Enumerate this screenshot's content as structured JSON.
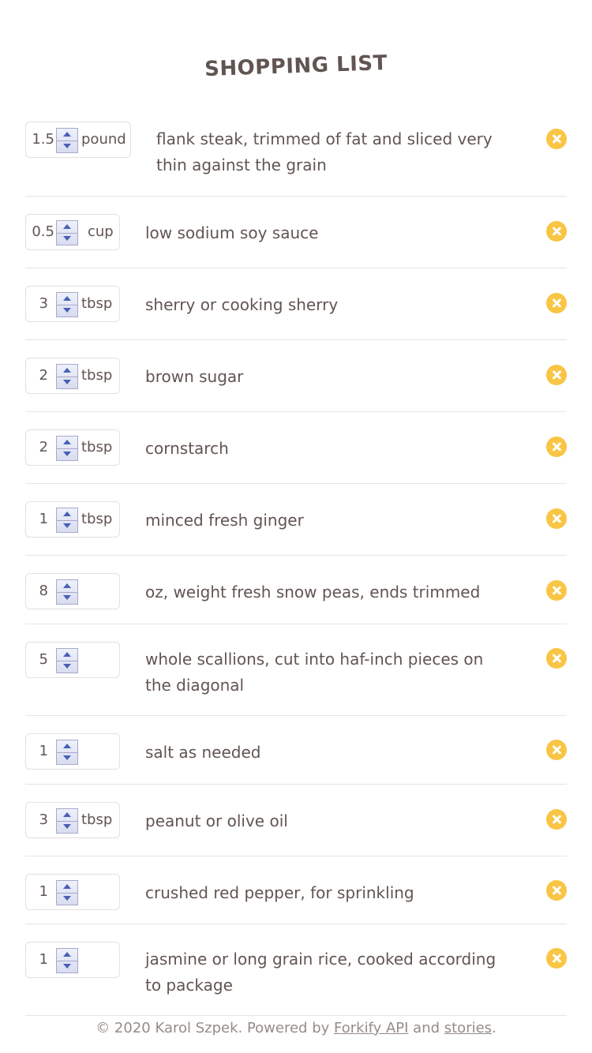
{
  "header": {
    "title": "SHOPPING LIST"
  },
  "items": [
    {
      "count": "1.5",
      "unit": "pound",
      "ingredient": "flank steak, trimmed of fat and sliced very thin against the grain"
    },
    {
      "count": "0.5",
      "unit": "cup",
      "ingredient": "low sodium soy sauce"
    },
    {
      "count": "3",
      "unit": "tbsp",
      "ingredient": "sherry or cooking sherry"
    },
    {
      "count": "2",
      "unit": "tbsp",
      "ingredient": "brown sugar"
    },
    {
      "count": "2",
      "unit": "tbsp",
      "ingredient": "cornstarch"
    },
    {
      "count": "1",
      "unit": "tbsp",
      "ingredient": "minced fresh ginger"
    },
    {
      "count": "8",
      "unit": "",
      "ingredient": "oz, weight fresh snow peas, ends trimmed"
    },
    {
      "count": "5",
      "unit": "",
      "ingredient": "whole scallions, cut into haf-inch pieces on the diagonal"
    },
    {
      "count": "1",
      "unit": "",
      "ingredient": "salt as needed"
    },
    {
      "count": "3",
      "unit": "tbsp",
      "ingredient": "peanut or olive oil"
    },
    {
      "count": "1",
      "unit": "",
      "ingredient": "crushed red pepper, for sprinkling"
    },
    {
      "count": "1",
      "unit": "",
      "ingredient": "jasmine or long grain rice, cooked according to package"
    }
  ],
  "footer": {
    "copyright": "© 2020 Karol Szpek. Powered by ",
    "link_api": "Forkify API",
    "and": " and ",
    "link_stories": "stories",
    "end": "."
  },
  "colors": {
    "text": "#615551",
    "accent": "#f9c544",
    "divider": "#e8e4e2"
  },
  "icons": {
    "delete": "close-circle-icon",
    "spinner": "stepper-arrows-icon"
  }
}
